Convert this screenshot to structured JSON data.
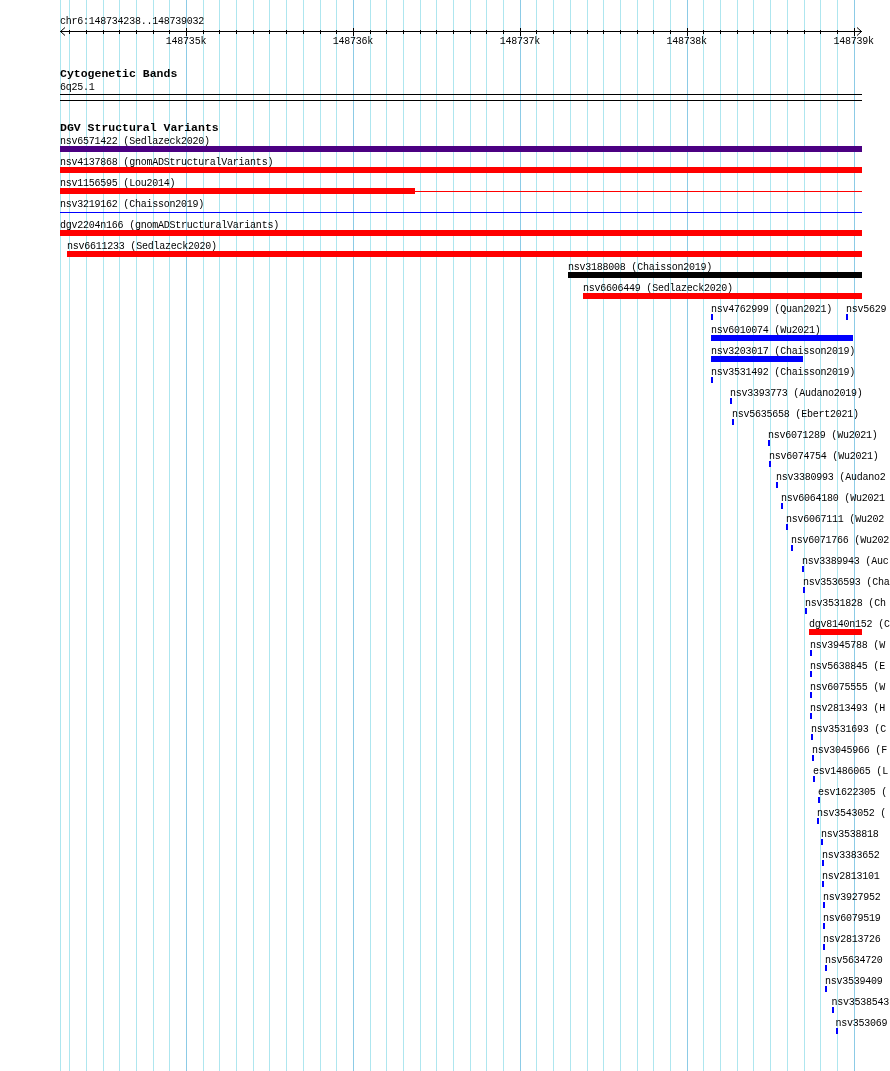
{
  "ruler": {
    "region": "chr6:148734238..148739032",
    "ticks": [
      "148735k",
      "148736k",
      "148737k",
      "148738k",
      "148739k"
    ]
  },
  "tracks": [
    {
      "kind": "cytoband",
      "title": "Cytogenetic Bands",
      "bands": [
        {
          "name": "6q25.1"
        }
      ]
    },
    {
      "kind": "variants",
      "title": "DGV Structural Variants",
      "features": [
        {
          "label": "nsv6571422 (Sedlazeck2020)",
          "kind": "bar",
          "color": "#4b0082"
        },
        {
          "label": "nsv4137868 (gnomADStructuralVariants)",
          "kind": "bar",
          "color": "#ff0000"
        },
        {
          "label": "nsv1156595 (Lou2014)",
          "kind": "split",
          "color": "#ff0000"
        },
        {
          "label": "nsv3219162 (Chaisson2019)",
          "kind": "line",
          "color": "#0000ff"
        },
        {
          "label": "dgv2204n166 (gnomADStructuralVariants)",
          "kind": "bar",
          "color": "#ff0000"
        },
        {
          "label": "nsv6611233 (Sedlazeck2020)",
          "kind": "bar",
          "color": "#ff0000"
        },
        {
          "label": "nsv3188008 (Chaisson2019)",
          "kind": "bar",
          "color": "#000000"
        },
        {
          "label": "nsv6606449 (Sedlazeck2020)",
          "kind": "bar",
          "color": "#ff0000"
        },
        {
          "label": "nsv4762999 (Quan2021)",
          "kind": "bar",
          "color": "#0000ff"
        },
        {
          "label": "nsv5629",
          "kind": "bar",
          "color": "#0000ff"
        },
        {
          "label": "nsv6010074 (Wu2021)",
          "kind": "bar",
          "color": "#0000ff"
        },
        {
          "label": "nsv3203017 (Chaisson2019)",
          "kind": "bar",
          "color": "#0000ff"
        },
        {
          "label": "nsv3531492 (Chaisson2019)",
          "kind": "bar",
          "color": "#0000ff"
        },
        {
          "label": "nsv3393773 (Audano2019)",
          "kind": "bar",
          "color": "#0000ff"
        },
        {
          "label": "nsv5635658 (Ebert2021)",
          "kind": "bar",
          "color": "#0000ff"
        },
        {
          "label": "nsv6071289 (Wu2021)",
          "kind": "bar",
          "color": "#0000ff"
        },
        {
          "label": "nsv6074754 (Wu2021)",
          "kind": "bar",
          "color": "#0000ff"
        },
        {
          "label": "nsv3380993 (Audano2",
          "kind": "bar",
          "color": "#0000ff"
        },
        {
          "label": "nsv6064180 (Wu2021",
          "kind": "bar",
          "color": "#0000ff"
        },
        {
          "label": "nsv6067111 (Wu202",
          "kind": "bar",
          "color": "#0000ff"
        },
        {
          "label": "nsv6071766 (Wu202",
          "kind": "bar",
          "color": "#0000ff"
        },
        {
          "label": "nsv3389943 (Auc",
          "kind": "bar",
          "color": "#0000ff"
        },
        {
          "label": "nsv3536593 (Cha",
          "kind": "bar",
          "color": "#0000ff"
        },
        {
          "label": "nsv3531828 (Ch",
          "kind": "bar",
          "color": "#0000ff"
        },
        {
          "label": "dgv8140n152 (C",
          "kind": "bar",
          "color": "#ff0000"
        },
        {
          "label": "nsv3945788 (W",
          "kind": "bar",
          "color": "#0000ff"
        },
        {
          "label": "nsv5638845 (E",
          "kind": "bar",
          "color": "#0000ff"
        },
        {
          "label": "nsv6075555 (W",
          "kind": "bar",
          "color": "#0000ff"
        },
        {
          "label": "nsv2813493 (H",
          "kind": "bar",
          "color": "#0000ff"
        },
        {
          "label": "nsv3531693 (C",
          "kind": "bar",
          "color": "#0000ff"
        },
        {
          "label": "nsv3045966 (F",
          "kind": "bar",
          "color": "#0000ff"
        },
        {
          "label": "esv1486065 (L",
          "kind": "bar",
          "color": "#0000ff"
        },
        {
          "label": "esv1622305 (",
          "kind": "bar",
          "color": "#0000ff"
        },
        {
          "label": "nsv3543052 (",
          "kind": "bar",
          "color": "#0000ff"
        },
        {
          "label": "nsv3538818",
          "kind": "bar",
          "color": "#0000ff"
        },
        {
          "label": "nsv3383652",
          "kind": "bar",
          "color": "#0000ff"
        },
        {
          "label": "nsv2813101",
          "kind": "bar",
          "color": "#0000ff"
        },
        {
          "label": "nsv3927952",
          "kind": "bar",
          "color": "#0000ff"
        },
        {
          "label": "nsv6079519",
          "kind": "bar",
          "color": "#0000ff"
        },
        {
          "label": "nsv2813726",
          "kind": "bar",
          "color": "#0000ff"
        },
        {
          "label": "nsv5634720",
          "kind": "bar",
          "color": "#0000ff"
        },
        {
          "label": "nsv3539409",
          "kind": "bar",
          "color": "#0000ff"
        },
        {
          "label": "nsv3538543",
          "kind": "bar",
          "color": "#0000ff"
        },
        {
          "label": "nsv353069",
          "kind": "bar",
          "color": "#0000ff"
        }
      ]
    }
  ]
}
